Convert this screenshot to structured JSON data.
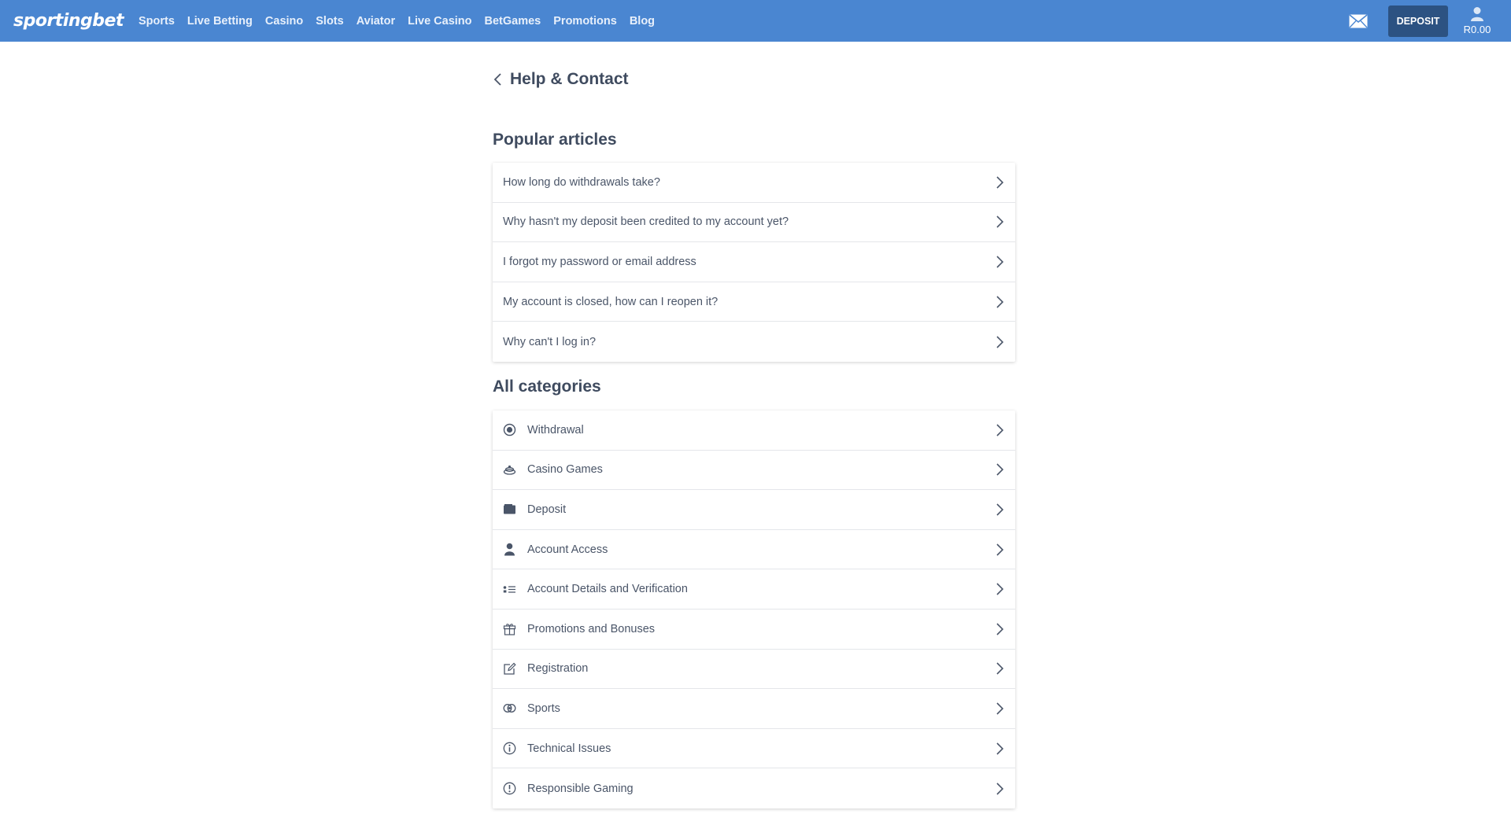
{
  "header": {
    "logo_text": "sportingbet",
    "nav": [
      "Sports",
      "Live Betting",
      "Casino",
      "Slots",
      "Aviator",
      "Live Casino",
      "BetGames",
      "Promotions",
      "Blog"
    ],
    "deposit_label": "DEPOSIT",
    "balance": "R0.00",
    "brand_color": "#4a86d1",
    "deposit_color": "#2c5282"
  },
  "page": {
    "title": "Help & Contact"
  },
  "popular": {
    "title": "Popular articles",
    "items": [
      "How long do withdrawals take?",
      "Why hasn't my deposit been credited to my account yet?",
      "I forgot my password or email address",
      "My account is closed, how can I reopen it?",
      "Why can't I log in?"
    ]
  },
  "categories": {
    "title": "All categories",
    "items": [
      {
        "label": "Withdrawal",
        "icon": "withdrawal-icon"
      },
      {
        "label": "Casino Games",
        "icon": "casino-chip-icon"
      },
      {
        "label": "Deposit",
        "icon": "wallet-icon"
      },
      {
        "label": "Account Access",
        "icon": "user-icon"
      },
      {
        "label": "Account Details and Verification",
        "icon": "details-list-icon"
      },
      {
        "label": "Promotions and Bonuses",
        "icon": "gift-icon"
      },
      {
        "label": "Registration",
        "icon": "edit-icon"
      },
      {
        "label": "Sports",
        "icon": "sports-ball-icon"
      },
      {
        "label": "Technical Issues",
        "icon": "info-icon"
      },
      {
        "label": "Responsible Gaming",
        "icon": "alert-icon"
      }
    ]
  }
}
